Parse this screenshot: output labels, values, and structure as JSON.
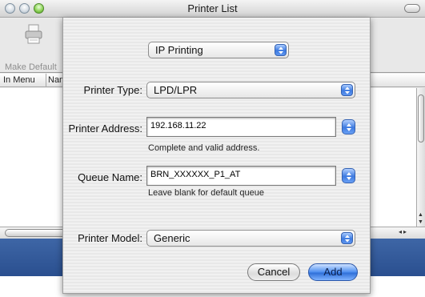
{
  "window": {
    "title": "Printer List",
    "toolbar": {
      "make_default_label": "Make Default"
    },
    "columns": [
      {
        "label": "In Menu"
      },
      {
        "label": "Nam"
      }
    ]
  },
  "sheet": {
    "connection_popup": {
      "value": "IP Printing"
    },
    "printer_type": {
      "label": "Printer Type:",
      "value": "LPD/LPR"
    },
    "printer_address": {
      "label": "Printer Address:",
      "value": "192.168.11.22",
      "hint": "Complete and valid address."
    },
    "queue_name": {
      "label": "Queue Name:",
      "value": "BRN_XXXXXX_P1_AT",
      "hint": "Leave blank for default queue"
    },
    "printer_model": {
      "label": "Printer Model:",
      "value": "Generic"
    },
    "buttons": {
      "cancel": "Cancel",
      "add": "Add"
    }
  },
  "colors": {
    "accent": "#3d7ae0",
    "desktop_bar": "#2f5898"
  }
}
